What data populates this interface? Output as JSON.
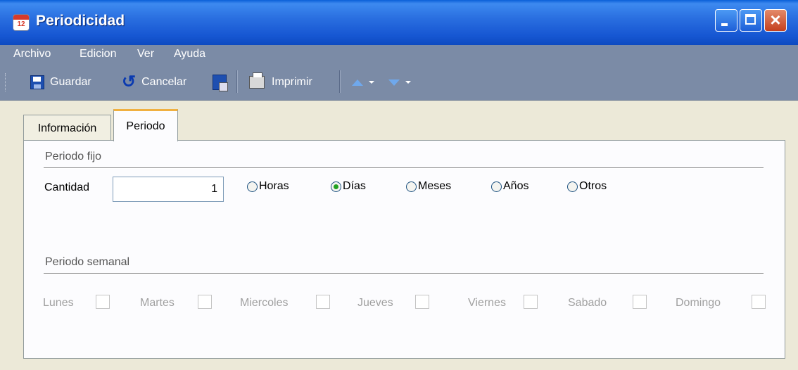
{
  "window": {
    "title": "Periodicidad",
    "icon_number": "12"
  },
  "menu": {
    "items": [
      "Archivo",
      "Edicion",
      "Ver",
      "Ayuda"
    ]
  },
  "toolbar": {
    "save_label": "Guardar",
    "cancel_label": "Cancelar",
    "print_label": "Imprimir"
  },
  "tabs": [
    "Información",
    "Periodo"
  ],
  "active_tab": "Periodo",
  "periodo_fijo": {
    "title": "Periodo fijo",
    "cantidad_label": "Cantidad",
    "cantidad_value": "1",
    "options": [
      "Horas",
      "Días",
      "Meses",
      "Años",
      "Otros"
    ],
    "selected": "Días"
  },
  "periodo_semanal": {
    "title": "Periodo semanal",
    "days": [
      "Lunes",
      "Martes",
      "Miercoles",
      "Jueves",
      "Viernes",
      "Sabado",
      "Domingo"
    ]
  },
  "colors": {
    "titlebar": "#1656d2",
    "toolbar_bg": "#7b8ba6",
    "active_tab_accent": "#f0b040",
    "radio_selected": "#21a121",
    "disabled_text": "#a0a0a0"
  }
}
